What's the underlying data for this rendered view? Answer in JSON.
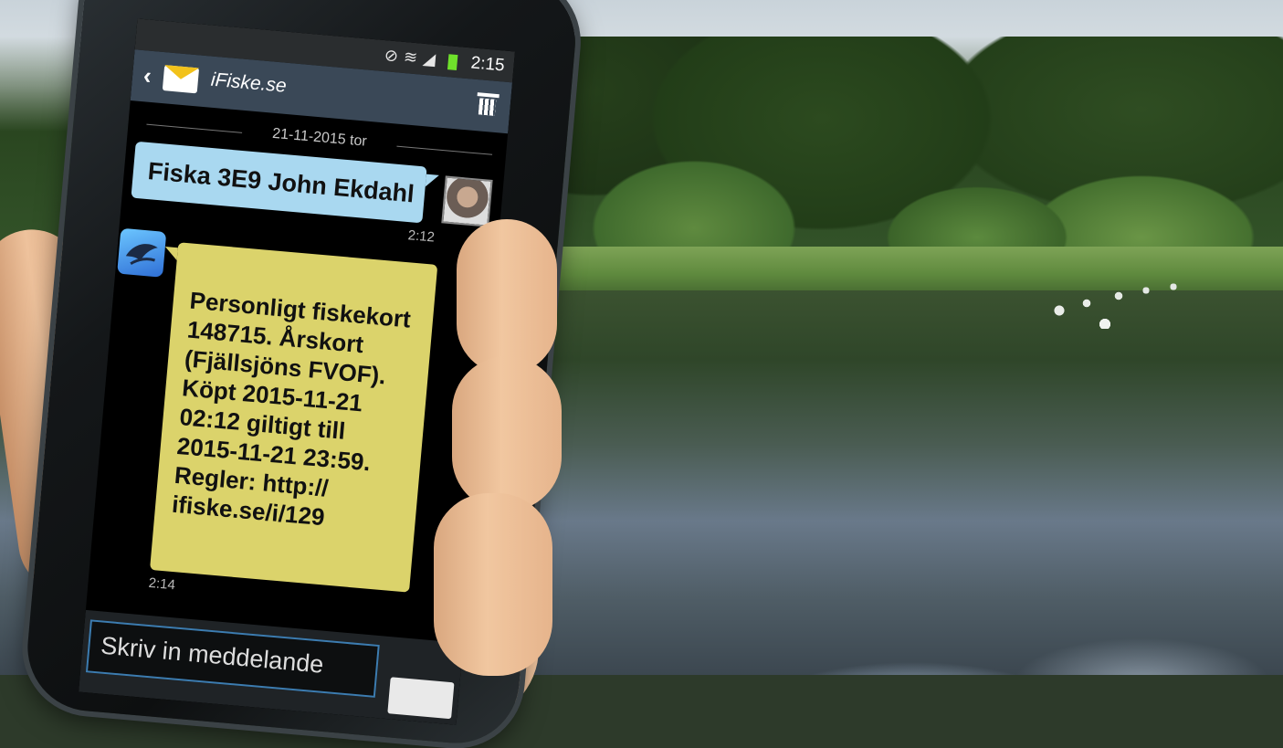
{
  "status_bar": {
    "time": "2:15",
    "icons": [
      "silent-icon",
      "wifi-icon",
      "signal-icon",
      "battery-icon"
    ]
  },
  "app_bar": {
    "title": "iFiske.se",
    "back_icon": "back-chevron-icon",
    "contact_icon": "mail-icon",
    "delete_icon": "trash-icon"
  },
  "conversation": {
    "date_separator": "21-11-2015 tor",
    "messages": [
      {
        "direction": "outgoing",
        "text": "Fiska 3E9 John Ekdahl",
        "time": "2:12"
      },
      {
        "direction": "incoming",
        "text": "Personligt fiskekort\n148715. Årskort\n(Fjällsjöns FVOF).\nKöpt 2015-11-21\n02:12 giltigt till\n2015-11-21 23:59.\nRegler: http://\nifiske.se/i/129",
        "time": "2:14"
      }
    ]
  },
  "composer": {
    "placeholder": "Skriv in meddelande"
  },
  "colors": {
    "outgoing_bubble": "#a9d8f0",
    "incoming_bubble": "#dbd36b",
    "app_bar": "#3a4857",
    "battery": "#6fe12b"
  }
}
